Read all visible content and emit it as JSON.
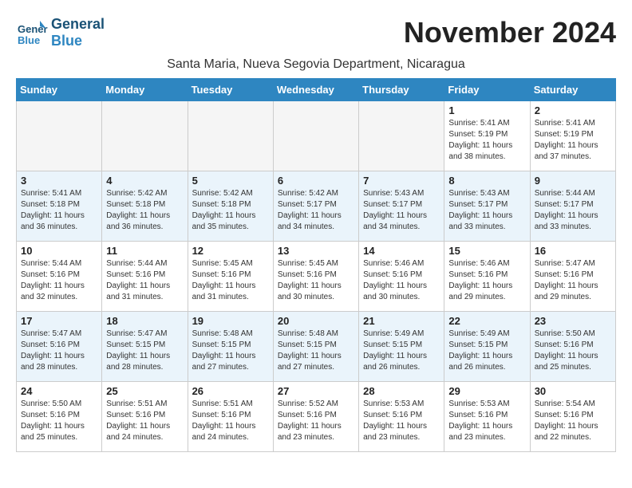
{
  "logo": {
    "line1": "General",
    "line2": "Blue"
  },
  "title": "November 2024",
  "location": "Santa Maria, Nueva Segovia Department, Nicaragua",
  "days_of_week": [
    "Sunday",
    "Monday",
    "Tuesday",
    "Wednesday",
    "Thursday",
    "Friday",
    "Saturday"
  ],
  "weeks": [
    [
      {
        "day": "",
        "info": ""
      },
      {
        "day": "",
        "info": ""
      },
      {
        "day": "",
        "info": ""
      },
      {
        "day": "",
        "info": ""
      },
      {
        "day": "",
        "info": ""
      },
      {
        "day": "1",
        "info": "Sunrise: 5:41 AM\nSunset: 5:19 PM\nDaylight: 11 hours\nand 38 minutes."
      },
      {
        "day": "2",
        "info": "Sunrise: 5:41 AM\nSunset: 5:19 PM\nDaylight: 11 hours\nand 37 minutes."
      }
    ],
    [
      {
        "day": "3",
        "info": "Sunrise: 5:41 AM\nSunset: 5:18 PM\nDaylight: 11 hours\nand 36 minutes."
      },
      {
        "day": "4",
        "info": "Sunrise: 5:42 AM\nSunset: 5:18 PM\nDaylight: 11 hours\nand 36 minutes."
      },
      {
        "day": "5",
        "info": "Sunrise: 5:42 AM\nSunset: 5:18 PM\nDaylight: 11 hours\nand 35 minutes."
      },
      {
        "day": "6",
        "info": "Sunrise: 5:42 AM\nSunset: 5:17 PM\nDaylight: 11 hours\nand 34 minutes."
      },
      {
        "day": "7",
        "info": "Sunrise: 5:43 AM\nSunset: 5:17 PM\nDaylight: 11 hours\nand 34 minutes."
      },
      {
        "day": "8",
        "info": "Sunrise: 5:43 AM\nSunset: 5:17 PM\nDaylight: 11 hours\nand 33 minutes."
      },
      {
        "day": "9",
        "info": "Sunrise: 5:44 AM\nSunset: 5:17 PM\nDaylight: 11 hours\nand 33 minutes."
      }
    ],
    [
      {
        "day": "10",
        "info": "Sunrise: 5:44 AM\nSunset: 5:16 PM\nDaylight: 11 hours\nand 32 minutes."
      },
      {
        "day": "11",
        "info": "Sunrise: 5:44 AM\nSunset: 5:16 PM\nDaylight: 11 hours\nand 31 minutes."
      },
      {
        "day": "12",
        "info": "Sunrise: 5:45 AM\nSunset: 5:16 PM\nDaylight: 11 hours\nand 31 minutes."
      },
      {
        "day": "13",
        "info": "Sunrise: 5:45 AM\nSunset: 5:16 PM\nDaylight: 11 hours\nand 30 minutes."
      },
      {
        "day": "14",
        "info": "Sunrise: 5:46 AM\nSunset: 5:16 PM\nDaylight: 11 hours\nand 30 minutes."
      },
      {
        "day": "15",
        "info": "Sunrise: 5:46 AM\nSunset: 5:16 PM\nDaylight: 11 hours\nand 29 minutes."
      },
      {
        "day": "16",
        "info": "Sunrise: 5:47 AM\nSunset: 5:16 PM\nDaylight: 11 hours\nand 29 minutes."
      }
    ],
    [
      {
        "day": "17",
        "info": "Sunrise: 5:47 AM\nSunset: 5:16 PM\nDaylight: 11 hours\nand 28 minutes."
      },
      {
        "day": "18",
        "info": "Sunrise: 5:47 AM\nSunset: 5:15 PM\nDaylight: 11 hours\nand 28 minutes."
      },
      {
        "day": "19",
        "info": "Sunrise: 5:48 AM\nSunset: 5:15 PM\nDaylight: 11 hours\nand 27 minutes."
      },
      {
        "day": "20",
        "info": "Sunrise: 5:48 AM\nSunset: 5:15 PM\nDaylight: 11 hours\nand 27 minutes."
      },
      {
        "day": "21",
        "info": "Sunrise: 5:49 AM\nSunset: 5:15 PM\nDaylight: 11 hours\nand 26 minutes."
      },
      {
        "day": "22",
        "info": "Sunrise: 5:49 AM\nSunset: 5:15 PM\nDaylight: 11 hours\nand 26 minutes."
      },
      {
        "day": "23",
        "info": "Sunrise: 5:50 AM\nSunset: 5:16 PM\nDaylight: 11 hours\nand 25 minutes."
      }
    ],
    [
      {
        "day": "24",
        "info": "Sunrise: 5:50 AM\nSunset: 5:16 PM\nDaylight: 11 hours\nand 25 minutes."
      },
      {
        "day": "25",
        "info": "Sunrise: 5:51 AM\nSunset: 5:16 PM\nDaylight: 11 hours\nand 24 minutes."
      },
      {
        "day": "26",
        "info": "Sunrise: 5:51 AM\nSunset: 5:16 PM\nDaylight: 11 hours\nand 24 minutes."
      },
      {
        "day": "27",
        "info": "Sunrise: 5:52 AM\nSunset: 5:16 PM\nDaylight: 11 hours\nand 23 minutes."
      },
      {
        "day": "28",
        "info": "Sunrise: 5:53 AM\nSunset: 5:16 PM\nDaylight: 11 hours\nand 23 minutes."
      },
      {
        "day": "29",
        "info": "Sunrise: 5:53 AM\nSunset: 5:16 PM\nDaylight: 11 hours\nand 23 minutes."
      },
      {
        "day": "30",
        "info": "Sunrise: 5:54 AM\nSunset: 5:16 PM\nDaylight: 11 hours\nand 22 minutes."
      }
    ]
  ]
}
